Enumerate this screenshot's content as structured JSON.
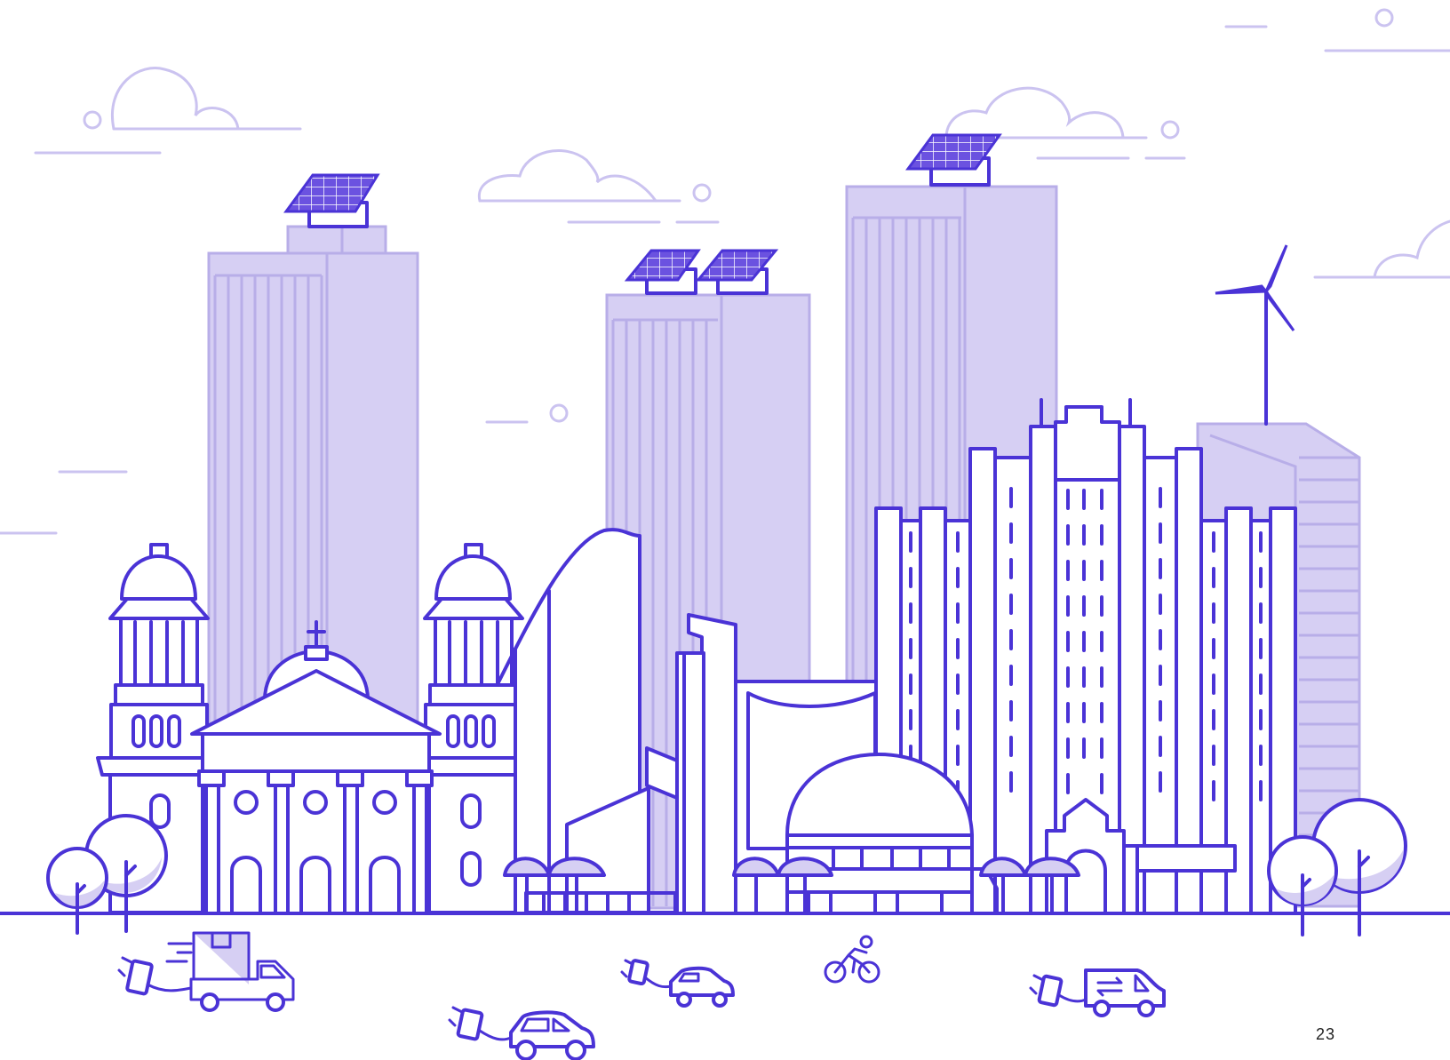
{
  "page": {
    "number": "23"
  },
  "colors": {
    "stroke": "#4a33d6",
    "fill": "#d6cff3",
    "cloud": "#cbc3f0",
    "white": "#ffffff"
  }
}
